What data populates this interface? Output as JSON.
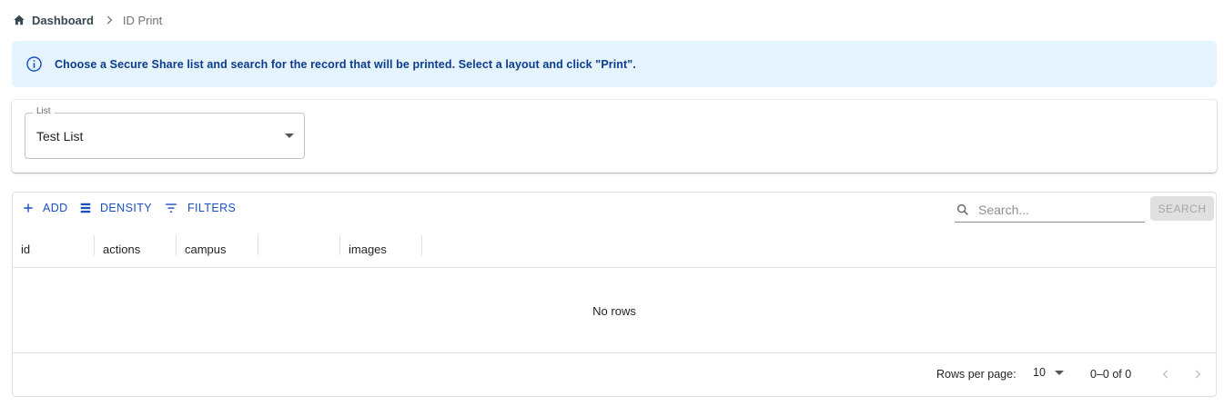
{
  "breadcrumb": {
    "home": "Dashboard",
    "current": "ID Print"
  },
  "alert": {
    "message": "Choose a Secure Share list and search for the record that will be printed. Select a layout and click \"Print\"."
  },
  "list_select": {
    "label": "List",
    "value": "Test List"
  },
  "toolbar": {
    "add_label": "ADD",
    "density_label": "DENSITY",
    "filters_label": "FILTERS",
    "search_placeholder": "Search...",
    "search_button": "SEARCH"
  },
  "columns": [
    "id",
    "actions",
    "campus",
    "",
    "images"
  ],
  "grid": {
    "empty_text": "No rows"
  },
  "pagination": {
    "rows_per_page_label": "Rows per page:",
    "rows_per_page": "10",
    "range": "0–0 of 0"
  },
  "colors": {
    "accent": "#1a4fbf",
    "alert_bg": "#e5f3fd",
    "alert_text": "#0d3c8c"
  }
}
